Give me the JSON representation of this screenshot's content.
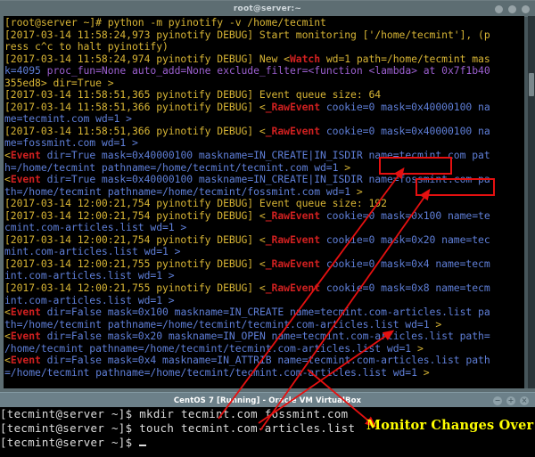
{
  "top_window": {
    "title": "root@server:~",
    "window_buttons": [
      "minimize-dot",
      "maximize-dot",
      "close-dot"
    ],
    "terminal_lines": [
      [
        {
          "t": "[root@server ~]# python -m pyinotify -v /home/tecmint",
          "c": "yel"
        }
      ],
      [
        {
          "t": "[2017-03-14 11:58:24,973 pyinotify DEBUG] Start monitoring ['/home/tecmint'], (p",
          "c": "yel"
        }
      ],
      [
        {
          "t": "ress c^c to halt pyinotify)",
          "c": "yel"
        }
      ],
      [
        {
          "t": "[2017-03-14 11:58:24,974 pyinotify DEBUG] New <",
          "c": "yel"
        },
        {
          "t": "Watch",
          "c": "red"
        },
        {
          "t": " wd=1 path=/home/tecmint mas",
          "c": "yel"
        }
      ],
      [
        {
          "t": "k=4095 ",
          "c": "blu"
        },
        {
          "t": "proc_fun=None auto_add=None exclude_filter=<function <lambda> at 0x7f1b40",
          "c": "pur"
        }
      ],
      [
        {
          "t": "355ed8> dir=True >",
          "c": "yel"
        }
      ],
      [
        {
          "t": "[2017-03-14 11:58:51,365 pyinotify DEBUG] Event queue size: 64",
          "c": "yel"
        }
      ],
      [
        {
          "t": "[2017-03-14 11:58:51,366 pyinotify DEBUG] <",
          "c": "yel"
        },
        {
          "t": "_RawEvent",
          "c": "red"
        },
        {
          "t": " cookie=0 mask=0x40000100 na",
          "c": "blu"
        }
      ],
      [
        {
          "t": "me=tecmint.com wd=1 >",
          "c": "blu"
        }
      ],
      [
        {
          "t": "[2017-03-14 11:58:51,366 pyinotify DEBUG] <",
          "c": "yel"
        },
        {
          "t": "_RawEvent",
          "c": "red"
        },
        {
          "t": " cookie=0 mask=0x40000100 na",
          "c": "blu"
        }
      ],
      [
        {
          "t": "me=fossmint.com wd=1 >",
          "c": "blu"
        }
      ],
      [
        {
          "t": "<",
          "c": "yel"
        },
        {
          "t": "Event",
          "c": "red"
        },
        {
          "t": " dir=True mask=0x40000100 maskname=IN_CREATE|IN_ISDIR name=tecmint.com pat",
          "c": "blu"
        }
      ],
      [
        {
          "t": "h=/home/tecmint pathname=/home/tecmint/tecmint.com wd=1 ",
          "c": "blu"
        },
        {
          "t": ">",
          "c": "yel"
        }
      ],
      [
        {
          "t": "<",
          "c": "yel"
        },
        {
          "t": "Event",
          "c": "red"
        },
        {
          "t": " dir=True mask=0x40000100 maskname=IN_CREATE|IN_ISDIR name=fossmint.com pa",
          "c": "blu"
        }
      ],
      [
        {
          "t": "th=/home/tecmint pathname=/home/tecmint/fossmint.com wd=1 ",
          "c": "blu"
        },
        {
          "t": ">",
          "c": "yel"
        }
      ],
      [
        {
          "t": "[2017-03-14 12:00:21,754 pyinotify DEBUG] Event queue size: 192",
          "c": "yel"
        }
      ],
      [
        {
          "t": "[2017-03-14 12:00:21,754 pyinotify DEBUG] <",
          "c": "yel"
        },
        {
          "t": "_RawEvent",
          "c": "red"
        },
        {
          "t": " cookie=0 mask=0x100 name=te",
          "c": "blu"
        }
      ],
      [
        {
          "t": "cmint.com-articles.list wd=1 >",
          "c": "blu"
        }
      ],
      [
        {
          "t": "[2017-03-14 12:00:21,754 pyinotify DEBUG] <",
          "c": "yel"
        },
        {
          "t": "_RawEvent",
          "c": "red"
        },
        {
          "t": " cookie=0 mask=0x20 name=tec",
          "c": "blu"
        }
      ],
      [
        {
          "t": "mint.com-articles.list wd=1 >",
          "c": "blu"
        }
      ],
      [
        {
          "t": "[2017-03-14 12:00:21,755 pyinotify DEBUG] <",
          "c": "yel"
        },
        {
          "t": "_RawEvent",
          "c": "red"
        },
        {
          "t": " cookie=0 mask=0x4 name=tecm",
          "c": "blu"
        }
      ],
      [
        {
          "t": "int.com-articles.list wd=1 >",
          "c": "blu"
        }
      ],
      [
        {
          "t": "[2017-03-14 12:00:21,755 pyinotify DEBUG] <",
          "c": "yel"
        },
        {
          "t": "_RawEvent",
          "c": "red"
        },
        {
          "t": " cookie=0 mask=0x8 name=tecm",
          "c": "blu"
        }
      ],
      [
        {
          "t": "int.com-articles.list wd=1 >",
          "c": "blu"
        }
      ],
      [
        {
          "t": "<",
          "c": "yel"
        },
        {
          "t": "Event",
          "c": "red"
        },
        {
          "t": " dir=False mask=0x100 maskname=IN_CREATE name=tecmint.com-articles.list pa",
          "c": "blu"
        }
      ],
      [
        {
          "t": "th=/home/tecmint pathname=/home/tecmint/tecmint.com-articles.list wd=1 ",
          "c": "blu"
        },
        {
          "t": ">",
          "c": "yel"
        }
      ],
      [
        {
          "t": "<",
          "c": "yel"
        },
        {
          "t": "Event",
          "c": "red"
        },
        {
          "t": " dir=False mask=0x20 maskname=IN_OPEN name=tecmint.com-articles.list path=",
          "c": "blu"
        }
      ],
      [
        {
          "t": "/home/tecmint pathname=/home/tecmint/tecmint.com-articles.list wd=1 ",
          "c": "blu"
        },
        {
          "t": ">",
          "c": "yel"
        }
      ],
      [
        {
          "t": "<",
          "c": "yel"
        },
        {
          "t": "Event",
          "c": "red"
        },
        {
          "t": " dir=False mask=0x4 maskname=IN_ATTRIB name=tecmint.com-articles.list path",
          "c": "blu"
        }
      ],
      [
        {
          "t": "=/home/tecmint pathname=/home/tecmint/tecmint.com-articles.list wd=1 ",
          "c": "blu"
        },
        {
          "t": ">",
          "c": "yel"
        }
      ]
    ]
  },
  "bottom_window": {
    "title": "CentOS 7 [Running] - Oracle VM VirtualBox",
    "window_buttons": [
      "minimize-icon",
      "maximize-icon",
      "close-icon"
    ],
    "button_glyphs": [
      "−",
      "+",
      "×"
    ],
    "terminal_lines": [
      "[tecmint@server ~]$ mkdir tecmint.com fossmint.com",
      "[tecmint@server ~]$ touch tecmint.com-articles.list",
      "[tecmint@server ~]$ "
    ],
    "annotation_label": "Monitor Changes Over SSH"
  },
  "annotations": {
    "highlight_boxes": [
      {
        "id": "tecmint",
        "label": "tecmint.com"
      },
      {
        "id": "fossmint",
        "label": "fossmint.com"
      }
    ],
    "accent_color": "#e51010",
    "annotation_text_color": "#ffff00"
  }
}
